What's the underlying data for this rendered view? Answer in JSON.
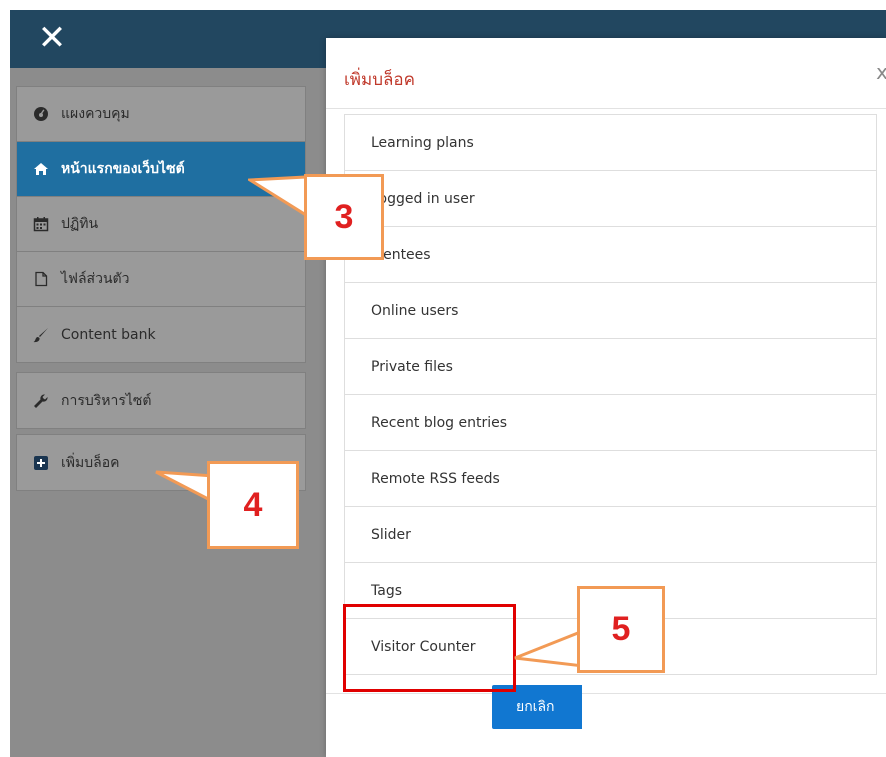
{
  "close_icon": "close-icon",
  "sidebar": {
    "groups": [
      [
        {
          "label": "แผงควบคุม",
          "icon": "dashboard-icon"
        },
        {
          "label": "หน้าแรกของเว็บไซต์",
          "icon": "home-icon",
          "active": true
        },
        {
          "label": "ปฏิทิน",
          "icon": "calendar-icon"
        },
        {
          "label": "ไฟล์ส่วนตัว",
          "icon": "file-icon"
        },
        {
          "label": "Content bank",
          "icon": "brush-icon"
        }
      ],
      [
        {
          "label": "การบริหารไซต์",
          "icon": "wrench-icon"
        }
      ],
      [
        {
          "label": "เพิ่มบล็อค",
          "icon": "plus-square-icon"
        }
      ]
    ]
  },
  "modal": {
    "title": "เพิ่มบล็อค",
    "close_glyph": "x",
    "blocks": [
      "Learning plans",
      "Logged in user",
      "Mentees",
      "Online users",
      "Private files",
      "Recent blog entries",
      "Remote RSS feeds",
      "Slider",
      "Tags",
      "Visitor Counter"
    ],
    "cancel_label": "ยกเลิก"
  },
  "callouts": [
    "3",
    "4",
    "5"
  ],
  "colors": {
    "topbar": "#224760",
    "active_nav": "#1f6fa1",
    "modal_title": "#c0392b",
    "callout_border": "#f29a55",
    "callout_text": "#e02020",
    "highlight": "#e00000",
    "cancel_button": "#1177d1"
  }
}
